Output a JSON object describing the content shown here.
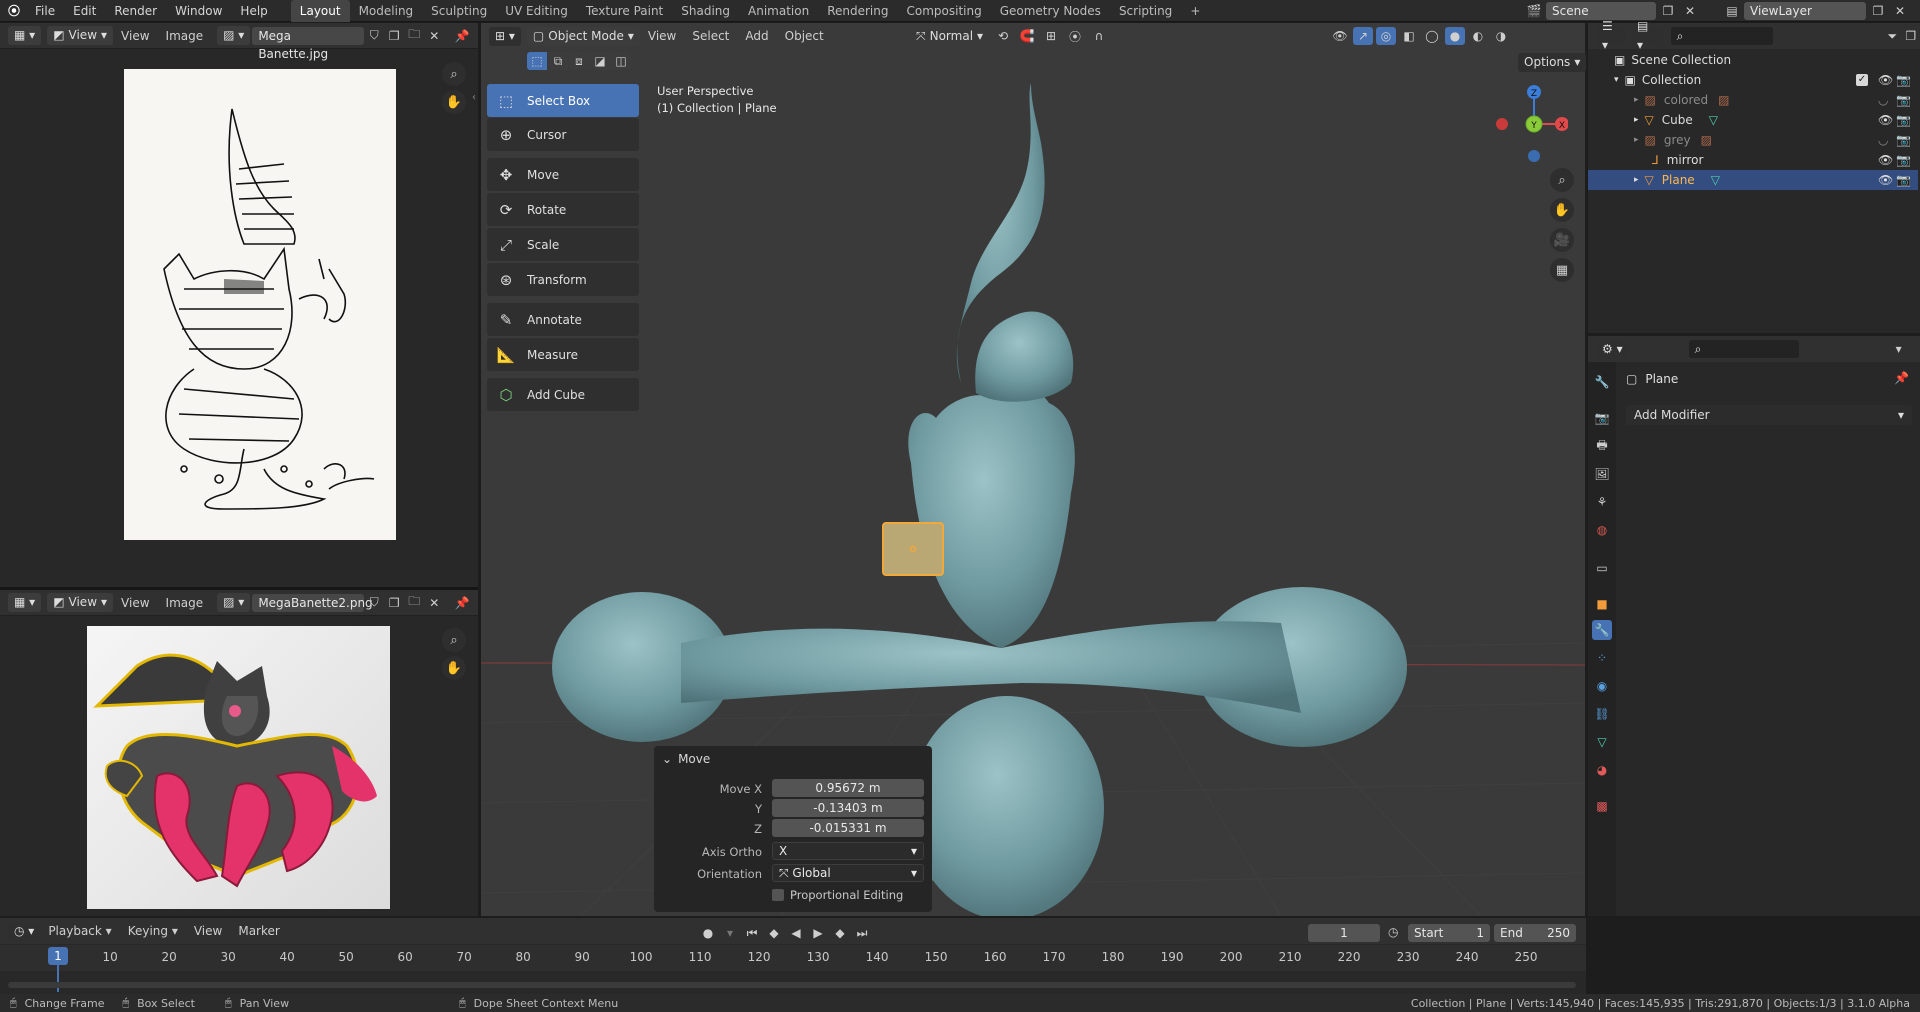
{
  "topbar": {
    "menus": [
      "File",
      "Edit",
      "Render",
      "Window",
      "Help"
    ],
    "workspaces": [
      "Layout",
      "Modeling",
      "Sculpting",
      "UV Editing",
      "Texture Paint",
      "Shading",
      "Animation",
      "Rendering",
      "Compositing",
      "Geometry Nodes",
      "Scripting"
    ],
    "active_workspace": "Layout",
    "add_tab": "+",
    "scene_label": "Scene",
    "viewlayer_label": "ViewLayer"
  },
  "image_editor_top": {
    "menus": [
      "View",
      "View",
      "Image"
    ],
    "image_name": "Mega Banette.jpg"
  },
  "image_editor_bottom": {
    "menus": [
      "View",
      "View",
      "Image"
    ],
    "image_name": "MegaBanette2.png"
  },
  "viewport": {
    "mode": "Object Mode",
    "menus": [
      "View",
      "Select",
      "Add",
      "Object"
    ],
    "orientation": "Normal",
    "options_label": "Options",
    "info_line1": "User Perspective",
    "info_line2": "(1) Collection | Plane",
    "gizmo_labels": {
      "z": "Z",
      "y": "Y",
      "x": "X"
    }
  },
  "toolbar": {
    "tools": [
      {
        "label": "Select Box",
        "icon": "select-box-icon",
        "active": true
      },
      {
        "label": "Cursor",
        "icon": "cursor-icon",
        "active": false
      },
      {
        "label": "Move",
        "icon": "move-icon",
        "active": false
      },
      {
        "label": "Rotate",
        "icon": "rotate-icon",
        "active": false
      },
      {
        "label": "Scale",
        "icon": "scale-icon",
        "active": false
      },
      {
        "label": "Transform",
        "icon": "transform-icon",
        "active": false
      },
      {
        "label": "Annotate",
        "icon": "annotate-icon",
        "active": false
      },
      {
        "label": "Measure",
        "icon": "measure-icon",
        "active": false
      },
      {
        "label": "Add Cube",
        "icon": "add-cube-icon",
        "active": false
      }
    ]
  },
  "operator_panel": {
    "title": "Move",
    "move_x_label": "Move X",
    "move_x": "0.95672 m",
    "y_label": "Y",
    "y": "-0.13403 m",
    "z_label": "Z",
    "z": "-0.015331 m",
    "axis_ortho_label": "Axis Ortho",
    "axis_ortho": "X",
    "orientation_label": "Orientation",
    "orientation": "Global",
    "proportional_label": "Proportional Editing"
  },
  "outliner": {
    "scene_collection": "Scene Collection",
    "collection": "Collection",
    "items": [
      {
        "name": "colored",
        "dim": true
      },
      {
        "name": "Cube",
        "dim": false
      },
      {
        "name": "grey",
        "dim": true
      },
      {
        "name": "mirror",
        "dim": false
      },
      {
        "name": "Plane",
        "dim": false,
        "selected": true
      }
    ]
  },
  "properties": {
    "object_name": "Plane",
    "add_modifier": "Add Modifier"
  },
  "timeline": {
    "menus": [
      "Playback",
      "Keying",
      "View",
      "Marker"
    ],
    "current_frame": "1",
    "start_label": "Start",
    "start": "1",
    "end_label": "End",
    "end": "250",
    "ticks": [
      "1",
      "10",
      "20",
      "30",
      "40",
      "50",
      "60",
      "70",
      "80",
      "90",
      "100",
      "110",
      "120",
      "130",
      "140",
      "150",
      "160",
      "170",
      "180",
      "190",
      "200",
      "210",
      "220",
      "230",
      "240",
      "250"
    ],
    "playhead": "1"
  },
  "statusbar": {
    "change_frame": "Change Frame",
    "box_select": "Box Select",
    "pan_view": "Pan View",
    "context_menu": "Dope Sheet Context Menu",
    "stats": "Collection | Plane | Verts:145,940 | Faces:145,935 | Tris:291,870 | Objects:1/3 | 3.1.0 Alpha"
  },
  "colors": {
    "accent": "#4772b3",
    "mesh": "#7aa3a8",
    "selected_outline": "#f2a93b"
  }
}
